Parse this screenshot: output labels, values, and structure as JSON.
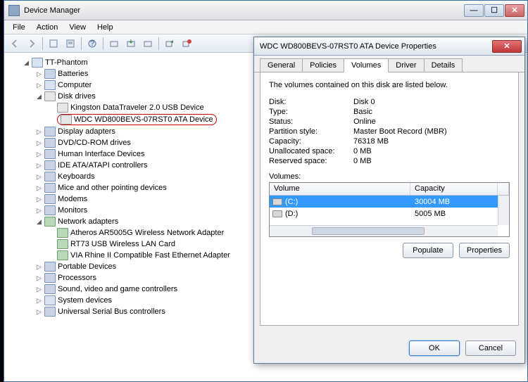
{
  "window": {
    "title": "Device Manager"
  },
  "menu": {
    "file": "File",
    "action": "Action",
    "view": "View",
    "help": "Help"
  },
  "tree": {
    "root": "TT-Phantom",
    "batteries": "Batteries",
    "computer": "Computer",
    "disk": "Disk drives",
    "disk_child1": "Kingston DataTraveler 2.0 USB Device",
    "disk_child2": "WDC WD800BEVS-07RST0 ATA Device",
    "display": "Display adapters",
    "dvd": "DVD/CD-ROM drives",
    "hid": "Human Interface Devices",
    "ide": "IDE ATA/ATAPI controllers",
    "keyboards": "Keyboards",
    "mice": "Mice and other pointing devices",
    "modems": "Modems",
    "monitors": "Monitors",
    "network": "Network adapters",
    "net1": "Atheros AR5005G Wireless Network Adapter",
    "net2": "RT73 USB Wireless LAN Card",
    "net3": "VIA Rhine II Compatible Fast Ethernet Adapter",
    "portable": "Portable Devices",
    "processors": "Processors",
    "sound": "Sound, video and game controllers",
    "system": "System devices",
    "usb": "Universal Serial Bus controllers"
  },
  "dialog": {
    "title": "WDC WD800BEVS-07RST0 ATA Device Properties",
    "tabs": {
      "general": "General",
      "policies": "Policies",
      "volumes": "Volumes",
      "driver": "Driver",
      "details": "Details"
    },
    "desc": "The volumes contained on this disk are listed below.",
    "props": {
      "disk_k": "Disk:",
      "disk_v": "Disk 0",
      "type_k": "Type:",
      "type_v": "Basic",
      "status_k": "Status:",
      "status_v": "Online",
      "part_k": "Partition style:",
      "part_v": "Master Boot Record (MBR)",
      "cap_k": "Capacity:",
      "cap_v": "76318 MB",
      "unalloc_k": "Unallocated space:",
      "unalloc_v": "0 MB",
      "res_k": "Reserved space:",
      "res_v": "0 MB"
    },
    "vol_label": "Volumes:",
    "vol_head": {
      "volume": "Volume",
      "capacity": "Capacity"
    },
    "vols": [
      {
        "name": "(C:)",
        "cap": "30004 MB"
      },
      {
        "name": "(D:)",
        "cap": "5005 MB"
      }
    ],
    "populate": "Populate",
    "properties": "Properties",
    "ok": "OK",
    "cancel": "Cancel"
  }
}
